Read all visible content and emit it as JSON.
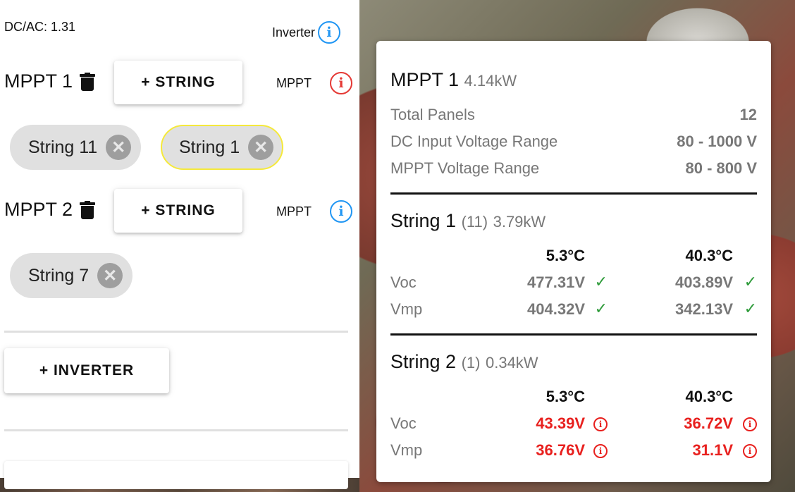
{
  "left": {
    "dc_ac": "DC/AC: 1.31",
    "inverter_info_label": "Inverter",
    "mppts": [
      {
        "title": "MPPT 1",
        "add_string_label": "+ STRING",
        "info_label": "MPPT",
        "info_status": "error",
        "strings": [
          {
            "label": "String 11",
            "selected": false
          },
          {
            "label": "String 1",
            "selected": true
          }
        ]
      },
      {
        "title": "MPPT 2",
        "add_string_label": "+ STRING",
        "info_label": "MPPT",
        "info_status": "ok",
        "strings": [
          {
            "label": "String 7",
            "selected": false
          }
        ]
      }
    ],
    "add_inverter_label": "+ INVERTER"
  },
  "card": {
    "title": "MPPT 1",
    "power": "4.14kW",
    "rows": [
      {
        "label": "Total Panels",
        "value": "12"
      },
      {
        "label": "DC Input Voltage Range",
        "value": "80 - 1000 V"
      },
      {
        "label": "MPPT Voltage Range",
        "value": "80 - 800 V"
      }
    ],
    "strings": [
      {
        "title": "String 1",
        "count": "(11)",
        "power": "3.79kW",
        "temp_low": "5.3°C",
        "temp_high": "40.3°C",
        "voc": {
          "label": "Voc",
          "low": "477.31V",
          "high": "403.89V",
          "status": "ok"
        },
        "vmp": {
          "label": "Vmp",
          "low": "404.32V",
          "high": "342.13V",
          "status": "ok"
        }
      },
      {
        "title": "String 2",
        "count": "(1)",
        "power": "0.34kW",
        "temp_low": "5.3°C",
        "temp_high": "40.3°C",
        "voc": {
          "label": "Voc",
          "low": "43.39V",
          "high": "36.72V",
          "status": "error"
        },
        "vmp": {
          "label": "Vmp",
          "low": "36.76V",
          "high": "31.1V",
          "status": "error"
        }
      }
    ]
  },
  "colors": {
    "info_blue": "#2196f3",
    "error_red": "#e8201e",
    "ok_green": "#2e9b3a",
    "selected_outline": "#f5e93b"
  }
}
